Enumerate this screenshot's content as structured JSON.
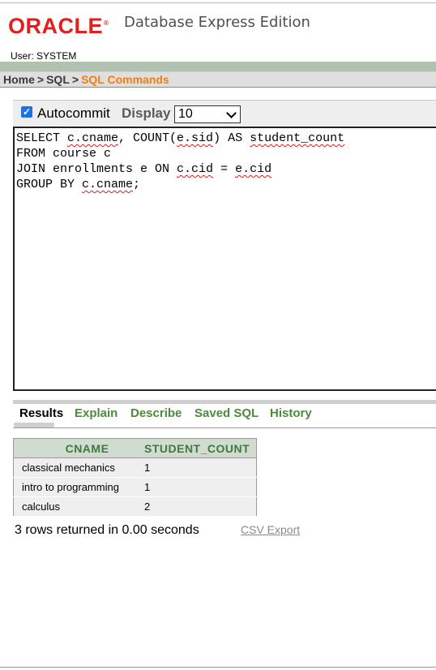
{
  "header": {
    "logo_text": "ORACLE",
    "logo_reg": "®",
    "product_name": "Database Express Edition",
    "user_line": "User: SYSTEM"
  },
  "breadcrumb": {
    "items": [
      "Home",
      "SQL",
      "SQL Commands"
    ],
    "separator": ">"
  },
  "toolbar": {
    "autocommit_label": "Autocommit",
    "autocommit_checked": true,
    "display_label": "Display",
    "display_value": "10"
  },
  "editor": {
    "lines": [
      "SELECT c.cname, COUNT(e.sid) AS student_count",
      "FROM course c",
      "JOIN enrollments e ON c.cid = e.cid",
      "GROUP BY c.cname;"
    ]
  },
  "tabs": [
    "Results",
    "Explain",
    "Describe",
    "Saved SQL",
    "History"
  ],
  "results": {
    "columns": [
      "CNAME",
      "STUDENT_COUNT"
    ],
    "rows": [
      [
        "classical mechanics",
        "1"
      ],
      [
        "intro to programming",
        "1"
      ],
      [
        "calculus",
        "2"
      ]
    ],
    "summary": "3 rows returned in 0.00 seconds",
    "csv_export_label": "CSV Export"
  },
  "colors": {
    "brand_red": "#e41e1c",
    "breadcrumb_current": "#f07f13",
    "tab_green": "#4b8b3b",
    "header_band": "#b1c2b1"
  }
}
